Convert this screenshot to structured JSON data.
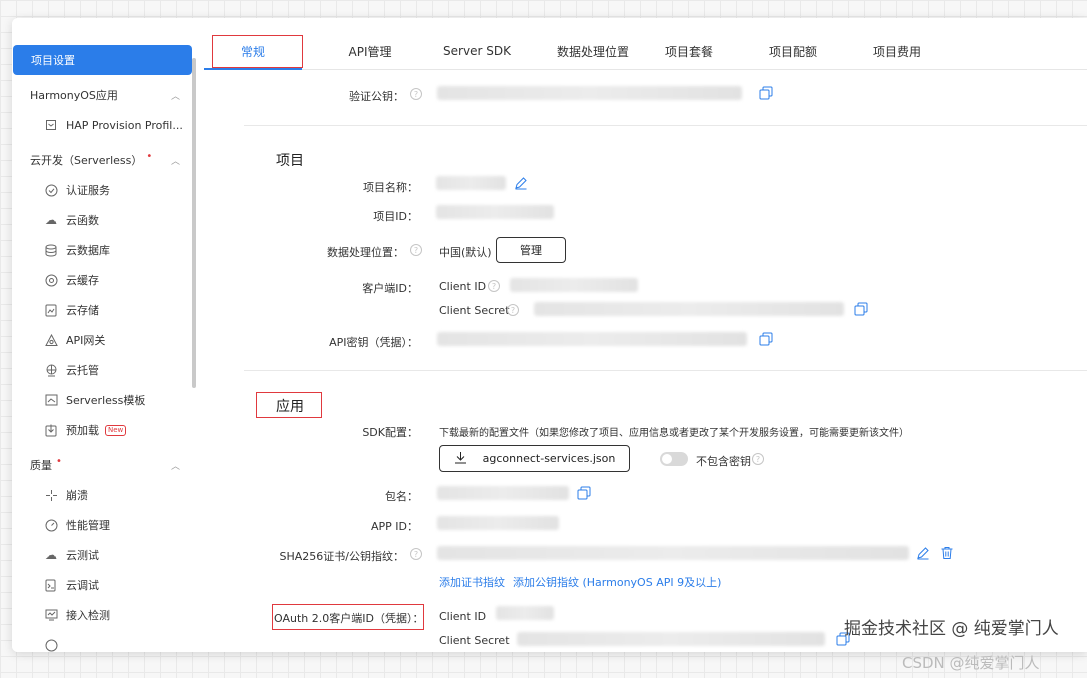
{
  "sidebar": {
    "active": "项目设置",
    "groups": [
      {
        "label": "HarmonyOS应用",
        "items": [
          {
            "label": "HAP Provision Profil...",
            "icon": "document-icon"
          }
        ]
      },
      {
        "label": "云开发（Serverless）",
        "dot": "•",
        "items": [
          {
            "label": "认证服务",
            "icon": "shield-check-icon"
          },
          {
            "label": "云函数",
            "icon": "cloud-function-icon"
          },
          {
            "label": "云数据库",
            "icon": "database-icon"
          },
          {
            "label": "云缓存",
            "icon": "cache-icon"
          },
          {
            "label": "云存储",
            "icon": "storage-icon"
          },
          {
            "label": "API网关",
            "icon": "gateway-icon"
          },
          {
            "label": "云托管",
            "icon": "hosting-icon"
          },
          {
            "label": "Serverless模板",
            "icon": "template-icon"
          },
          {
            "label": "预加载",
            "icon": "preload-icon",
            "badge": "New"
          }
        ]
      },
      {
        "label": "质量",
        "dot": "•",
        "items": [
          {
            "label": "崩溃",
            "icon": "crash-icon"
          },
          {
            "label": "性能管理",
            "icon": "gauge-icon"
          },
          {
            "label": "云测试",
            "icon": "cloud-test-icon"
          },
          {
            "label": "云调试",
            "icon": "debug-icon"
          },
          {
            "label": "接入检测",
            "icon": "monitor-icon"
          }
        ]
      }
    ]
  },
  "tabs": [
    "常规",
    "API管理",
    "Server SDK",
    "数据处理位置",
    "项目套餐",
    "项目配额",
    "项目费用"
  ],
  "top": {
    "verify_key_label": "验证公钥："
  },
  "project": {
    "title": "项目",
    "name_label": "项目名称：",
    "id_label": "项目ID：",
    "location_label": "数据处理位置：",
    "location_value": "中国(默认)",
    "manage_btn": "管理",
    "client_label": "客户端ID：",
    "client_id": "Client ID",
    "client_secret": "Client Secret",
    "api_key_label": "API密钥（凭据）："
  },
  "app": {
    "title": "应用",
    "sdk_label": "SDK配置：",
    "sdk_desc": "下载最新的配置文件（如果您修改了项目、应用信息或者更改了某个开发服务设置，可能需要更新该文件）",
    "download_btn": "agconnect-services.json",
    "exclude_key": "不包含密钥",
    "package_label": "包名：",
    "appid_label": "APP ID：",
    "sha_label": "SHA256证书/公钥指纹：",
    "add_cert": "添加证书指纹",
    "add_pubkey": "添加公钥指纹 (HarmonyOS API 9及以上)",
    "oauth_label": "OAuth 2.0客户端ID（凭据）：",
    "client_id": "Client ID",
    "client_secret": "Client Secret"
  },
  "watermarks": {
    "juejin": "掘金技术社区 @ 纯爱掌门人",
    "csdn": "CSDN @纯爱掌门人"
  },
  "colors": {
    "accent": "#2b7de9",
    "highlight_box": "#e0393e"
  }
}
